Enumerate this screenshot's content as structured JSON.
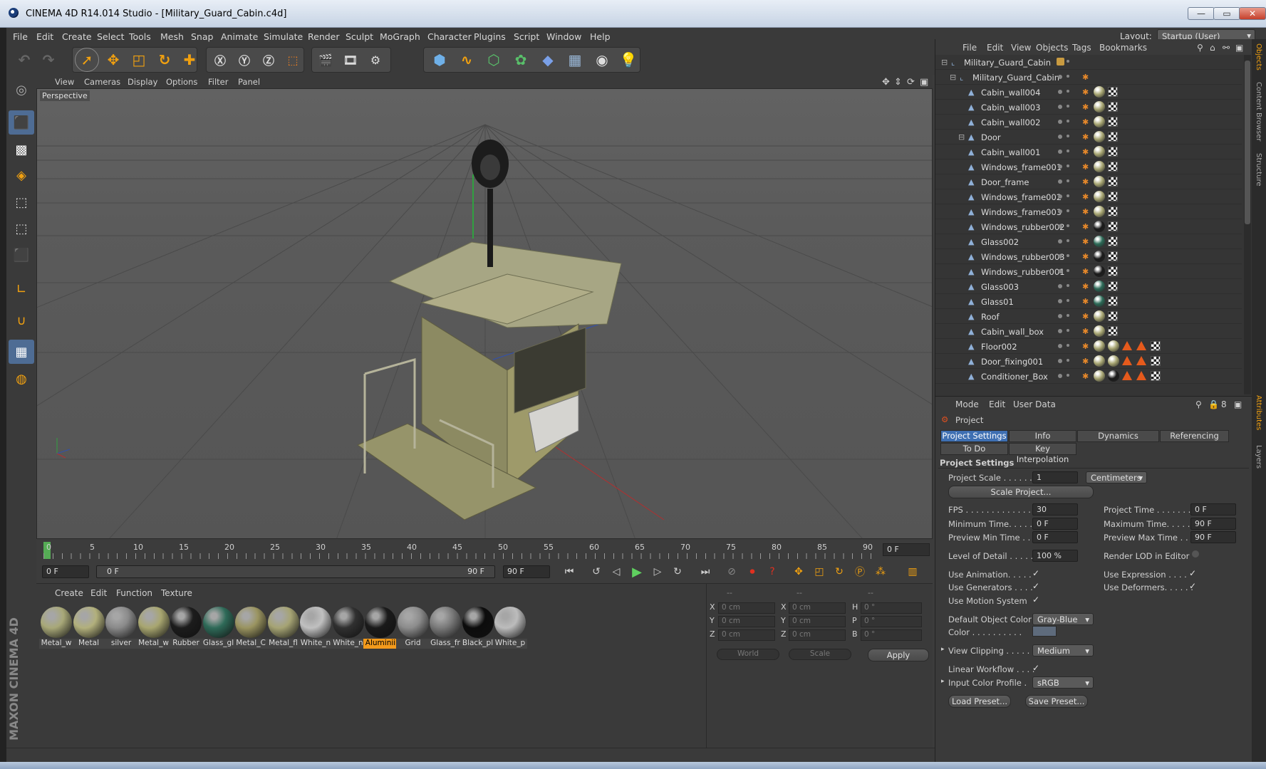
{
  "window": {
    "title": "CINEMA 4D R14.014 Studio - [Military_Guard_Cabin.c4d]",
    "min_label": "—",
    "max_label": "▭",
    "close_label": "✕"
  },
  "menubar": {
    "items": [
      "File",
      "Edit",
      "Create",
      "Select",
      "Tools",
      "Mesh",
      "Snap",
      "Animate",
      "Simulate",
      "Render",
      "Sculpt",
      "MoGraph",
      "Character",
      "Plugins",
      "Script",
      "Window",
      "Help"
    ],
    "layout_label": "Layout:",
    "layout_value": "Startup (User)"
  },
  "viewport": {
    "menu": [
      "View",
      "Cameras",
      "Display",
      "Options",
      "Filter",
      "Panel"
    ],
    "camera_label": "Perspective"
  },
  "timeline": {
    "ticks": [
      "0",
      "5",
      "10",
      "15",
      "20",
      "25",
      "30",
      "35",
      "40",
      "45",
      "50",
      "55",
      "60",
      "65",
      "70",
      "75",
      "80",
      "85",
      "90"
    ],
    "current_frame": "0 F",
    "start_field": "0 F",
    "range_start": "0 F",
    "range_end": "90 F",
    "end_field": "90 F"
  },
  "materials": {
    "menu": [
      "Create",
      "Edit",
      "Function",
      "Texture"
    ],
    "items": [
      {
        "name": "Metal_w",
        "color": "#a8a878"
      },
      {
        "name": "Metal",
        "color": "#b2b07c"
      },
      {
        "name": "silver",
        "color": "#8a8a8a"
      },
      {
        "name": "Metal_w",
        "color": "#a8a670"
      },
      {
        "name": "Rubber",
        "color": "#1c1c1c"
      },
      {
        "name": "Glass_gl",
        "color": "#2e6a58"
      },
      {
        "name": "Metal_C",
        "color": "#9a9460"
      },
      {
        "name": "Metal_fl",
        "color": "#a6a474"
      },
      {
        "name": "White_n",
        "color": "#c0c0c0"
      },
      {
        "name": "White_n",
        "color": "#303030"
      },
      {
        "name": "Aluminii",
        "color": "#1a1a1a"
      },
      {
        "name": "Grid",
        "color": "#8c8c8c"
      },
      {
        "name": "Glass_fr",
        "color": "#7a7a7a"
      },
      {
        "name": "Black_pl",
        "color": "#0c0c0c"
      },
      {
        "name": "White_p",
        "color": "#bcbcbc"
      }
    ],
    "selected_index": 10
  },
  "coordinates": {
    "header": [
      "--",
      "--",
      "--"
    ],
    "rows": [
      {
        "a": "X",
        "av": "0 cm",
        "b": "X",
        "bv": "0 cm",
        "c": "H",
        "cv": "0 °"
      },
      {
        "a": "Y",
        "av": "0 cm",
        "b": "Y",
        "bv": "0 cm",
        "c": "P",
        "cv": "0 °"
      },
      {
        "a": "Z",
        "av": "0 cm",
        "b": "Z",
        "bv": "0 cm",
        "c": "B",
        "cv": "0 °"
      }
    ],
    "world_label": "World",
    "scale_label": "Scale",
    "apply_label": "Apply"
  },
  "logo_text": "MAXON CINEMA 4D",
  "objects": {
    "menu": [
      "File",
      "Edit",
      "View",
      "Objects",
      "Tags",
      "Bookmarks"
    ],
    "rows": [
      {
        "name": "Military_Guard_Cabin",
        "indent": 0,
        "tags": "root"
      },
      {
        "name": "Military_Guard_Cabin",
        "indent": 1,
        "tags": "null"
      },
      {
        "name": "Cabin_wall004",
        "indent": 2,
        "tags": "std"
      },
      {
        "name": "Cabin_wall003",
        "indent": 2,
        "tags": "std"
      },
      {
        "name": "Cabin_wall002",
        "indent": 2,
        "tags": "std"
      },
      {
        "name": "Door",
        "indent": 2,
        "tags": "std"
      },
      {
        "name": "Cabin_wall001",
        "indent": 2,
        "tags": "std"
      },
      {
        "name": "Windows_frame001",
        "indent": 2,
        "tags": "std"
      },
      {
        "name": "Door_frame",
        "indent": 2,
        "tags": "std"
      },
      {
        "name": "Windows_frame002",
        "indent": 2,
        "tags": "std"
      },
      {
        "name": "Windows_frame003",
        "indent": 2,
        "tags": "std"
      },
      {
        "name": "Windows_rubber002",
        "indent": 2,
        "tags": "dark"
      },
      {
        "name": "Glass002",
        "indent": 2,
        "tags": "glass"
      },
      {
        "name": "Windows_rubber003",
        "indent": 2,
        "tags": "dark"
      },
      {
        "name": "Windows_rubber001",
        "indent": 2,
        "tags": "dark"
      },
      {
        "name": "Glass003",
        "indent": 2,
        "tags": "glass"
      },
      {
        "name": "Glass01",
        "indent": 2,
        "tags": "glass"
      },
      {
        "name": "Roof",
        "indent": 2,
        "tags": "std"
      },
      {
        "name": "Cabin_wall_box",
        "indent": 2,
        "tags": "std"
      },
      {
        "name": "Floor002",
        "indent": 2,
        "tags": "multi"
      },
      {
        "name": "Door_fixing001",
        "indent": 2,
        "tags": "multi"
      },
      {
        "name": "Conditioner_Box",
        "indent": 2,
        "tags": "multi"
      }
    ]
  },
  "attributes": {
    "menu": [
      "Mode",
      "Edit",
      "User Data"
    ],
    "title": "Project",
    "tabs_row1": [
      "Project Settings",
      "Info",
      "Dynamics",
      "Referencing"
    ],
    "tabs_row2": [
      "To Do",
      "Key Interpolation"
    ],
    "section": "Project Settings",
    "project_scale_label": "Project Scale . . . . . .",
    "project_scale_value": "1",
    "project_scale_unit": "Centimeters",
    "scale_project_btn": "Scale Project...",
    "fps_label": "FPS . . . . . . . . . . . . .",
    "fps_value": "30",
    "project_time_label": "Project Time . . . . . . .",
    "project_time_value": "0 F",
    "min_time_label": "Minimum Time. . . . .",
    "min_time_value": "0 F",
    "max_time_label": "Maximum Time. . . . .",
    "max_time_value": "90 F",
    "prev_min_label": "Preview Min Time . .",
    "prev_min_value": "0 F",
    "prev_max_label": "Preview Max Time . .",
    "prev_max_value": "90 F",
    "lod_label": "Level of Detail . . . . .",
    "lod_value": "100 %",
    "render_lod_label": "Render LOD in Editor",
    "use_anim_label": "Use Animation. . . . .",
    "use_expr_label": "Use Expression . . . .",
    "use_gen_label": "Use Generators . . . .",
    "use_def_label": "Use Deformers. . . . . .",
    "use_motion_label": "Use Motion System",
    "default_color_label": "Default Object Color",
    "default_color_value": "Gray-Blue",
    "color_label": "Color . . . . . . . . . .",
    "view_clipping_label": "View Clipping . . . . . .",
    "view_clipping_value": "Medium",
    "linear_workflow_label": "Linear Workflow . . . .",
    "input_profile_label": "Input Color Profile .",
    "input_profile_value": "sRGB",
    "load_preset": "Load Preset...",
    "save_preset": "Save Preset..."
  },
  "right_strip_tabs": [
    "Objects",
    "Content Browser",
    "Structure",
    "Attributes",
    "Layers"
  ]
}
